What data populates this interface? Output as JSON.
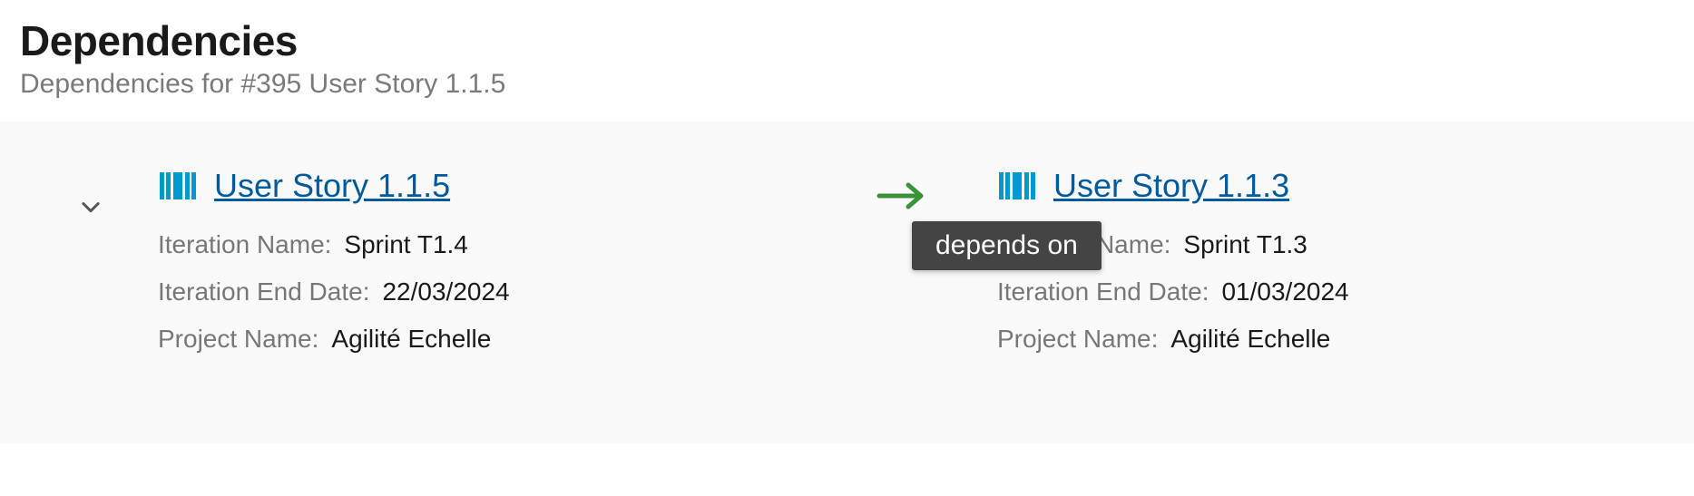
{
  "header": {
    "title": "Dependencies",
    "subtitle": "Dependencies for #395 User Story 1.1.5"
  },
  "labels": {
    "iteration_name": "Iteration Name:",
    "iteration_end_date": "Iteration End Date:",
    "project_name": "Project Name:"
  },
  "left_card": {
    "title": "User Story 1.1.5",
    "iteration_name": "Sprint T1.4",
    "iteration_end_date": "22/03/2024",
    "project_name": "Agilité Echelle"
  },
  "right_card": {
    "title": "User Story 1.1.3",
    "iteration_name": "Sprint T1.3",
    "iteration_end_date": "01/03/2024",
    "project_name": "Agilité Echelle"
  },
  "tooltip": "depends on"
}
